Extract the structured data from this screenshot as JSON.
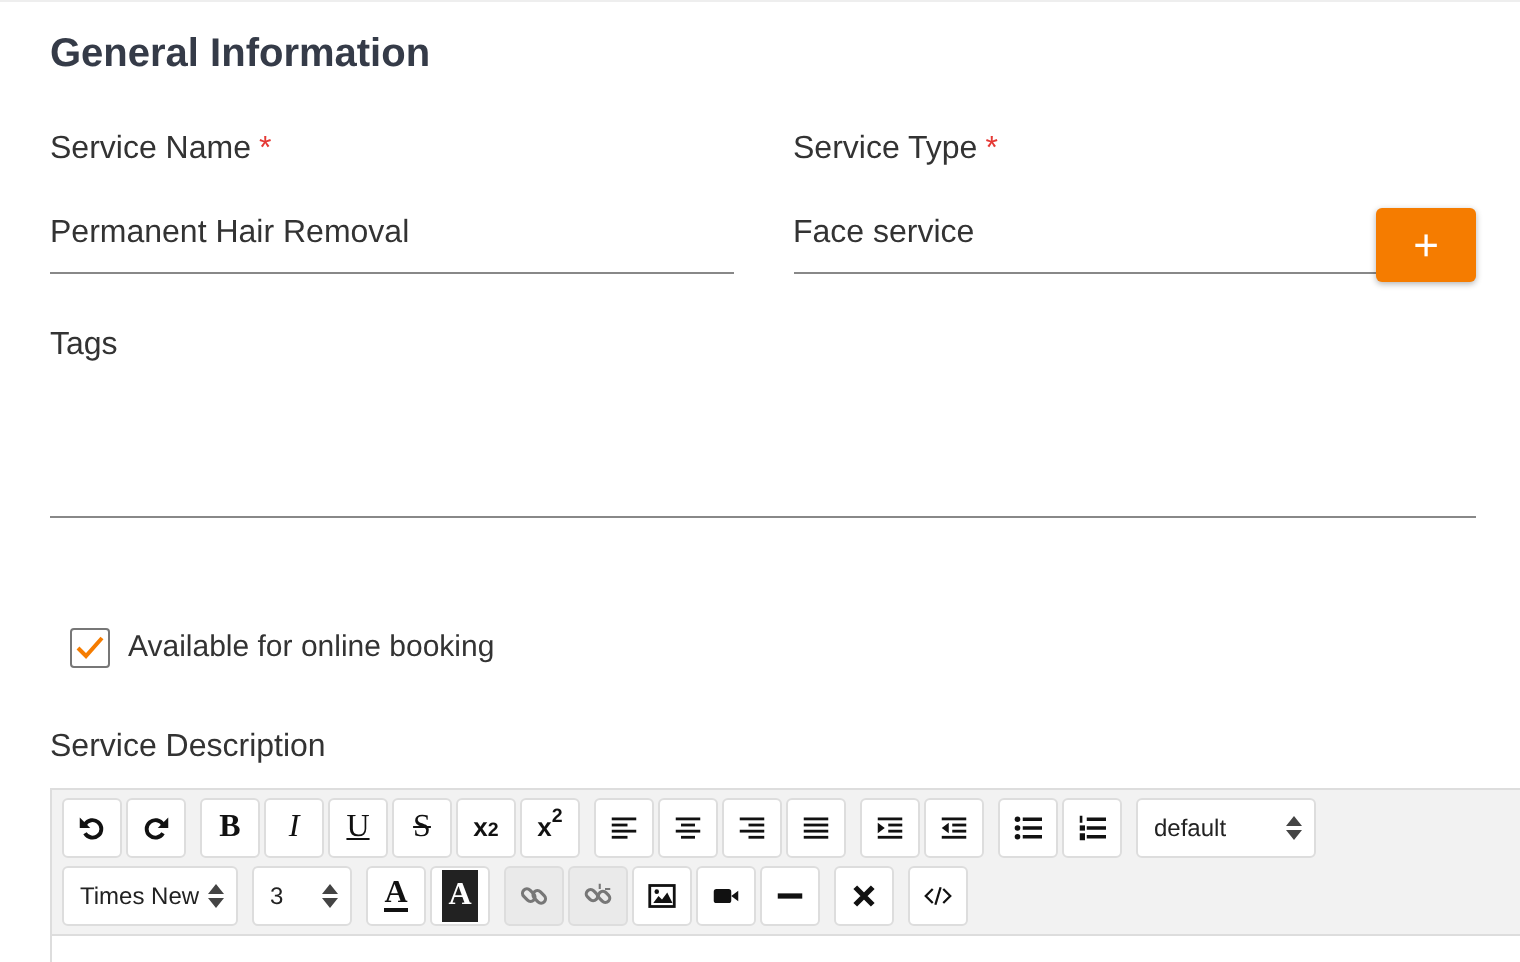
{
  "heading": "General Information",
  "fields": [
    {
      "label": "Service Name",
      "required_mark": "*",
      "value": "Permanent Hair Removal"
    },
    {
      "label": "Service Type",
      "required_mark": "*",
      "value": "Face service",
      "add_button": "+"
    },
    {
      "label": "Tags"
    }
  ],
  "online_booking": {
    "label": "Available for online booking",
    "checked": true
  },
  "description": {
    "label": "Service Description",
    "toolbar": [
      [
        [
          {
            "kind": "undo",
            "disabled": false
          },
          {
            "kind": "redo",
            "disabled": false
          }
        ],
        [
          {
            "kind": "bold",
            "label": "B",
            "disabled": false
          },
          {
            "kind": "italic",
            "label": "I",
            "disabled": false
          },
          {
            "kind": "underline",
            "label": "U",
            "disabled": false
          },
          {
            "kind": "strike",
            "label": "S",
            "disabled": false
          },
          {
            "kind": "subscript",
            "label": "x$_{2}$",
            "disabled": false
          },
          {
            "kind": "superscript",
            "label": "x$^{2}$",
            "disabled": false
          }
        ],
        [
          {
            "kind": "alignleft",
            "disabled": false
          },
          {
            "kind": "aligncenter",
            "disabled": false
          },
          {
            "kind": "alignright",
            "disabled": false
          },
          {
            "kind": "justify",
            "disabled": false
          }
        ],
        [
          {
            "kind": "indent",
            "disabled": false
          },
          {
            "kind": "outdent",
            "disabled": false
          }
        ],
        [
          {
            "kind": "bullets",
            "disabled": false
          },
          {
            "kind": "numbers",
            "disabled": false
          }
        ],
        [
          {
            "kind": "select",
            "label": "default",
            "disabled": false
          }
        ]
      ],
      [
        [
          {
            "kind": "select",
            "label": "Times New",
            "disabled": false
          }
        ],
        [
          {
            "kind": "select",
            "label": "3",
            "disabled": false
          }
        ],
        [
          {
            "kind": "forecolor",
            "label": "A",
            "disabled": false
          },
          {
            "kind": "backcolor",
            "label": "A",
            "disabled": false
          }
        ],
        [
          {
            "kind": "link",
            "disabled": true
          },
          {
            "kind": "unlink",
            "disabled": true
          },
          {
            "kind": "image",
            "disabled": false
          },
          {
            "kind": "video",
            "disabled": false
          },
          {
            "kind": "rule",
            "disabled": false
          }
        ],
        [
          {
            "kind": "clear",
            "disabled": false
          }
        ],
        [
          {
            "kind": "code",
            "disabled": false
          }
        ]
      ]
    ]
  }
}
